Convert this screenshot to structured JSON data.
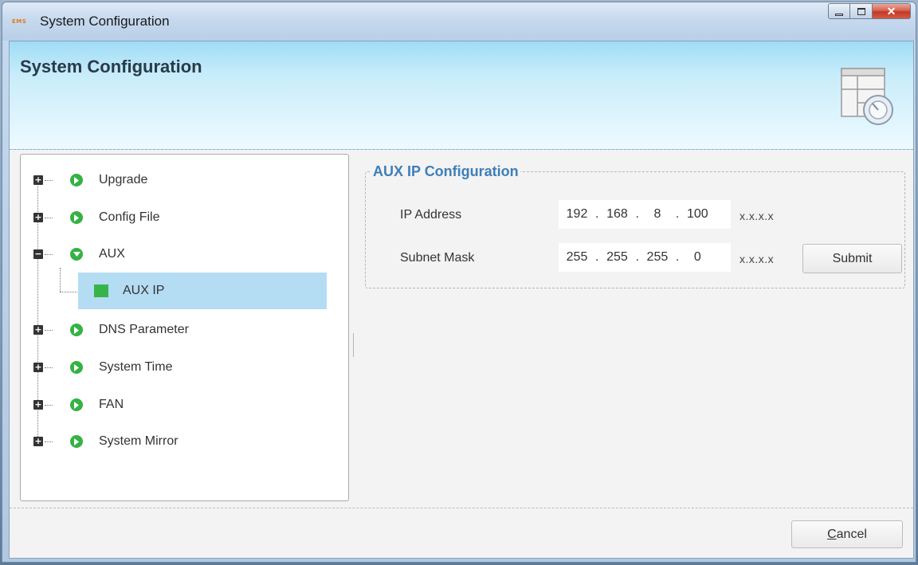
{
  "window": {
    "title": "System Configuration",
    "app_icon_text": "EMS"
  },
  "header": {
    "title": "System Configuration",
    "icon": "settings-window-icon"
  },
  "tree": {
    "items": [
      {
        "label": "Upgrade",
        "expander": "+",
        "icon": "green-arrow-icon"
      },
      {
        "label": "Config File",
        "expander": "+",
        "icon": "green-arrow-icon"
      },
      {
        "label": "AUX",
        "expander": "−",
        "icon": "green-arrow-down-icon"
      },
      {
        "label": "AUX IP",
        "icon": "green-square-icon",
        "selected": true
      },
      {
        "label": "DNS Parameter",
        "expander": "+",
        "icon": "green-arrow-icon"
      },
      {
        "label": "System Time",
        "expander": "+",
        "icon": "green-arrow-icon"
      },
      {
        "label": "FAN",
        "expander": "+",
        "icon": "green-arrow-icon"
      },
      {
        "label": "System Mirror",
        "expander": "+",
        "icon": "green-arrow-icon"
      }
    ]
  },
  "aux_ip": {
    "group_title": "AUX IP Configuration",
    "ip_address": {
      "label": "IP Address",
      "octets": [
        "192",
        "168",
        "8",
        "100"
      ],
      "hint": "x.x.x.x"
    },
    "subnet_mask": {
      "label": "Subnet Mask",
      "octets": [
        "255",
        "255",
        "255",
        "0"
      ],
      "hint": "x.x.x.x"
    },
    "submit_label": "Submit"
  },
  "footer": {
    "cancel_label": "Cancel",
    "cancel_mnemonic": "C"
  },
  "colors": {
    "accent": "#3e7fb8",
    "selection": "#b4dcf2",
    "tree_icon": "#35b244"
  }
}
